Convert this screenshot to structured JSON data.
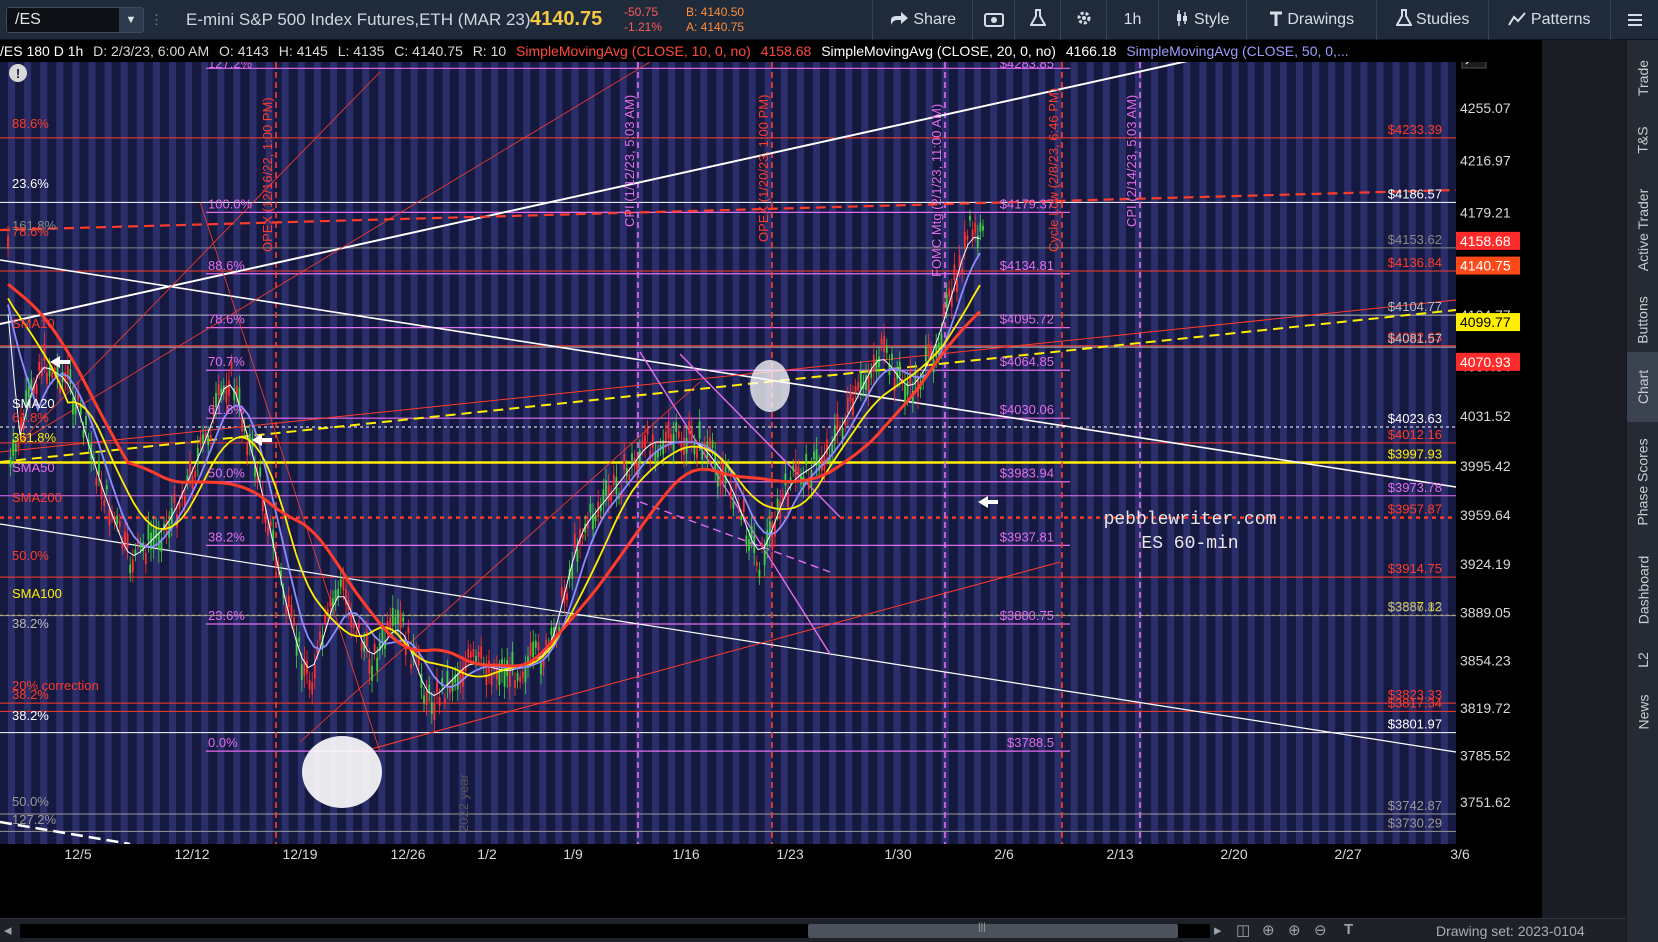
{
  "header": {
    "symbol": "/ES",
    "instrument": "E-mini S&P 500 Index Futures,ETH (MAR 23)",
    "last": "4140.75",
    "change": "-50.75",
    "change_pct": "-1.21%",
    "bid": "B: 4140.50",
    "ask": "A: 4140.75",
    "share": "Share",
    "timeframe": "1h",
    "style": "Style",
    "drawings": "Drawings",
    "studies": "Studies",
    "patterns": "Patterns"
  },
  "status": {
    "desc": "/ES 180 D 1h",
    "date": "D: 2/3/23, 6:00 AM",
    "open": "O: 4143",
    "high": "H: 4145",
    "low": "L: 4135",
    "close": "C: 4140.75",
    "range": "R: 10",
    "sma10": "SimpleMovingAvg (CLOSE, 10, 0, no)",
    "sma10_val": "4158.68",
    "sma20": "SimpleMovingAvg (CLOSE, 20, 0, no)",
    "sma20_val": "4166.18",
    "sma50": "SimpleMovingAvg (CLOSE, 50, 0,..."
  },
  "right_tabs": [
    "Trade",
    "T&S",
    "Active Trader",
    "Buttons",
    "Chart",
    "Phase Scores",
    "Dashboard",
    "L2",
    "News"
  ],
  "footer": {
    "drawing_set": "Drawing set: 2023-0104"
  },
  "chart": {
    "watermark": [
      "pebblewriter.com",
      "ES 60-min"
    ],
    "fibs_left": [
      "88.6%",
      "23.6%",
      "161.8%",
      "78.6%",
      "SMA10",
      "SMA20",
      "61.8%",
      "361.8%",
      "SMA50",
      "SMA200",
      "50.0%",
      "SMA100",
      "38.2%",
      "20% correction",
      "38.2%",
      "38.2%",
      "50.0%",
      "127.2%"
    ],
    "fibs_mid": [
      "127.2%",
      "100.0%",
      "88.6%",
      "78.6%",
      "70.7%",
      "61.8%",
      "50.0%",
      "38.2%",
      "23.6%",
      "0.0%"
    ],
    "fib_prices": [
      "$4283.85",
      "$4179.37",
      "$4134.81",
      "$4095.72",
      "$4064.85",
      "$4030.06",
      "$3983.94",
      "$3937.81",
      "$3880.75",
      "$3788.5"
    ],
    "right_labels": [
      "$4233.39",
      "$4186.57",
      "$4153.62",
      "$4136.84",
      "$4104.77",
      "$4082.63",
      "$4081.57",
      "$4023.63",
      "$4012.16",
      "$3997.93",
      "$3973.78",
      "$3957.87",
      "$3914.75",
      "$3887.12",
      "$3886.83",
      "$3823.33",
      "$3817.34",
      "$3801.97",
      "$3742.87",
      "$3730.29"
    ],
    "price_ticks": [
      "4255.07",
      "4216.97",
      "4179.21",
      "4141.27",
      "4104.77",
      "4067.64",
      "4031.52",
      "3995.42",
      "3959.64",
      "3924.19",
      "3889.05",
      "3854.23",
      "3819.72",
      "3785.52",
      "3751.62"
    ],
    "date_ticks": [
      "12/5",
      "12/12",
      "12/19",
      "12/26",
      "1/2",
      "1/9",
      "1/16",
      "1/23",
      "1/30",
      "2/6",
      "2/13",
      "2/20",
      "2/27",
      "3/6"
    ],
    "price_tags": [
      "4158.68",
      "4140.75",
      "4099.77",
      "4070.93"
    ],
    "vlabels": [
      "OPEX (12/16/22, 1:00 PM)",
      "CPI (1/12/23, 5:03 AM)",
      "OPEX (1/20/23, 1:00 PM)",
      "FOMC Mtg (2/1/23, 11:00 AM)",
      "Cycle Low (2/8/23, 6:46 PM)",
      "CPI (2/14/23, 5:03 AM)",
      "2022 year"
    ]
  },
  "colors": {
    "bg": "#16193f",
    "band": "#2a2e6a",
    "fib": "#e46cf0",
    "red": "#ff3b2a",
    "yellow": "#ffee00",
    "white": "#ffffff",
    "blue": "#8c8cff"
  }
}
